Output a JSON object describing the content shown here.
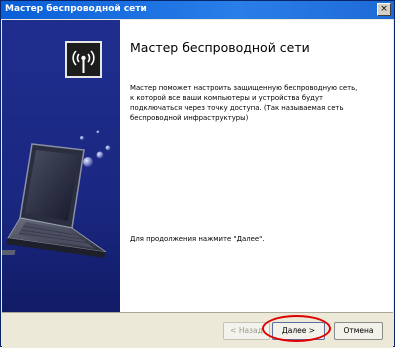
{
  "window": {
    "title": "Мастер беспроводной сети",
    "close_glyph": "×"
  },
  "wizard": {
    "heading": "Мастер беспроводной сети",
    "description": "Мастер поможет настроить защищенную беспроводную сеть, к которой все ваши компьютеры и устройства будут подключаться через точку доступа. (Так называемая сеть беспроводной инфраструктуры)",
    "continue_hint": "Для продолжения нажмите \"Далее\"."
  },
  "icons": {
    "logo": "wireless-antenna-icon",
    "sidebar_art": "laptop-illustration"
  },
  "buttons": {
    "back": "< Назад",
    "next": "Далее >",
    "cancel": "Отмена"
  },
  "annotation": {
    "highlight_target": "next-button",
    "highlight_color": "#e00000"
  }
}
